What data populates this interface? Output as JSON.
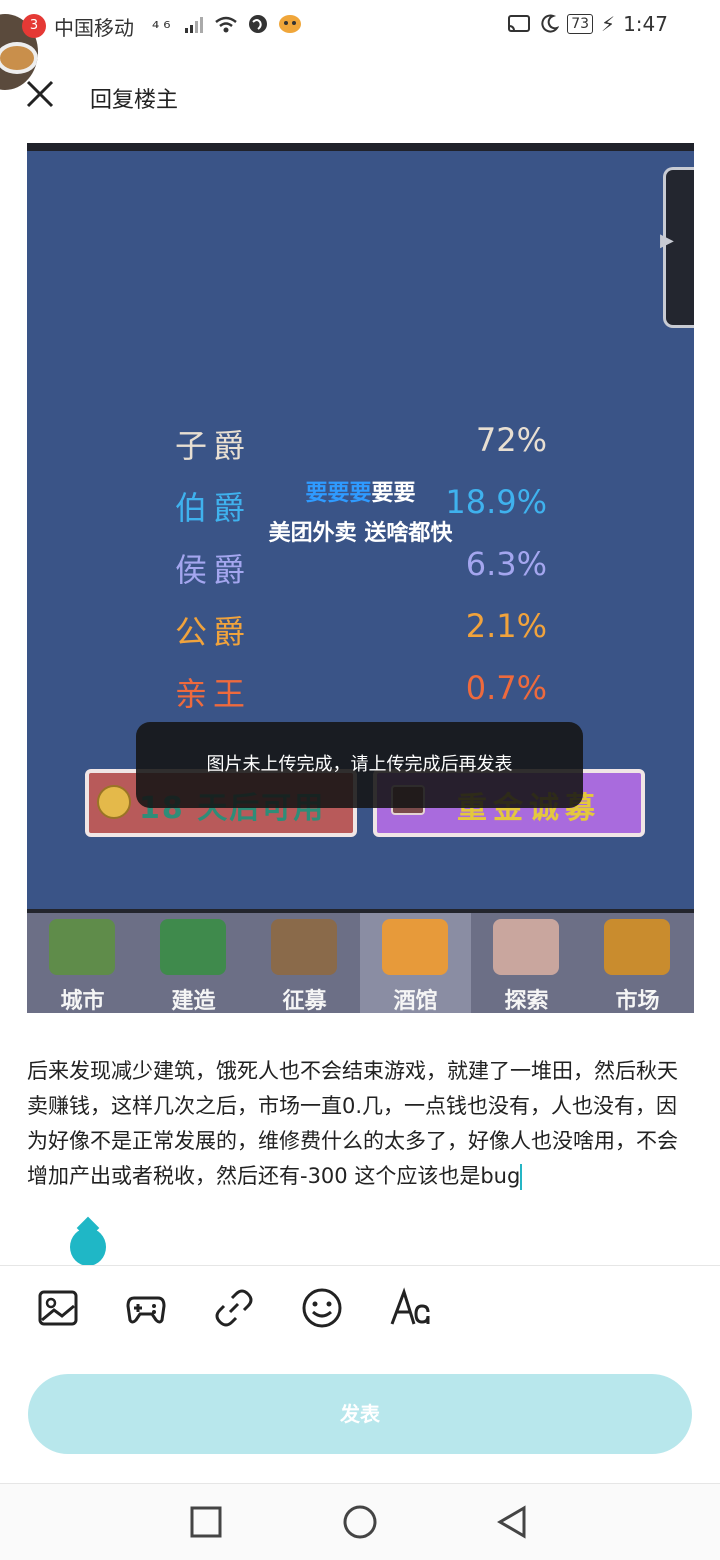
{
  "status_bar": {
    "notification_count": "3",
    "carrier": "中国移动",
    "signal_text": "⁴⁶",
    "battery": "73",
    "time": "1:47"
  },
  "header": {
    "title": "回复楼主"
  },
  "preview": {
    "ranks": [
      {
        "name": "子爵",
        "percent": "72%",
        "color": "#e8dfd2"
      },
      {
        "name": "伯爵",
        "percent": "18.9%",
        "color": "#3fb2ee"
      },
      {
        "name": "侯爵",
        "percent": "6.3%",
        "color": "#a4a6ef"
      },
      {
        "name": "公爵",
        "percent": "2.1%",
        "color": "#f1a33c"
      },
      {
        "name": "亲王",
        "percent": "0.7%",
        "color": "#ee6a3d"
      }
    ],
    "ad": {
      "line1_highlight": "要要要",
      "line1_rest": "要要",
      "line2": "美团外卖 送啥都快"
    },
    "buttons": {
      "wait_label": "18 天后可用",
      "recruit_label": "重金诚募"
    },
    "nav": [
      {
        "label": "城市"
      },
      {
        "label": "建造"
      },
      {
        "label": "征募"
      },
      {
        "label": "酒馆"
      },
      {
        "label": "探索"
      },
      {
        "label": "市场"
      }
    ]
  },
  "toast": {
    "message": "图片未上传完成，请上传完成后再发表"
  },
  "post": {
    "text": "后来发现减少建筑，饿死人也不会结束游戏，就建了一堆田，然后秋天卖赚钱，这样几次之后，市场一直0.几，一点钱也没有，人也没有，因为好像不是正常发展的，维修费什么的太多了，好像人也没啥用，不会增加产出或者税收，然后还有-300 这个应该也是bug"
  },
  "toolbar": {
    "icons": [
      "image-icon",
      "gamepad-icon",
      "link-icon",
      "emoji-icon",
      "text-format-icon"
    ]
  },
  "publish": {
    "label": "发表",
    "accent": "#b8e7ec"
  }
}
